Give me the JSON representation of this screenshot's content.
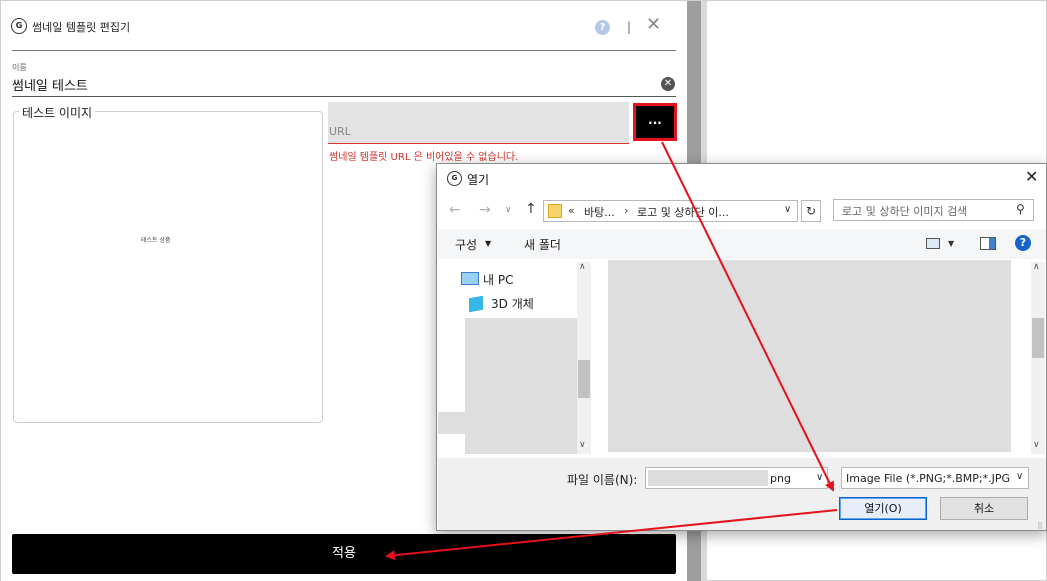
{
  "editor": {
    "icon_glyph": "G",
    "title": "썸네일 템플릿 편집기",
    "help_glyph": "?",
    "separator": "|",
    "close_glyph": "✕",
    "name_label": "이름",
    "name_value": "썸네일 테스트",
    "clear_glyph": "✕",
    "test_image_legend": "테스트 이미지",
    "product_caption": "테스트 상품",
    "url_placeholder": "URL",
    "url_error": "썸네일 템플릿 URL 은 비어있을 수 없습니다.",
    "browse_label": "...",
    "apply_label": "적용"
  },
  "dialog": {
    "icon_glyph": "G",
    "title": "열기",
    "close_glyph": "✕",
    "nav": {
      "back": "←",
      "forward": "→",
      "dropdown": "∨",
      "up": "↑",
      "refresh": "↻"
    },
    "address": {
      "chevron_start": "«",
      "segment1": "바탕...",
      "chevron": "›",
      "segment2": "로고 및 상하단 이...",
      "dropdown": "∨"
    },
    "search_placeholder": "로고 및 상하단 이미지 검색",
    "search_glyph": "⚲",
    "organize_label": "구성",
    "organize_dd": "▼",
    "new_folder_label": "새 폴더",
    "view_dd": "▼",
    "help_glyph": "?",
    "nav_items": [
      {
        "label": "내 PC",
        "icon": "computer-icon"
      },
      {
        "label": "3D 개체",
        "icon": "cube-icon"
      }
    ],
    "scroll_up": "∧",
    "scroll_down": "∨",
    "filename_label": "파일 이름(N):",
    "filename_ext": "png",
    "filename_dd": "∨",
    "filetype_value": "Image File  (*.PNG;*.BMP;*.JPG",
    "filetype_dd": "∨",
    "open_label": "열기(O)",
    "cancel_label": "취소",
    "grip_glyph": "⠿"
  },
  "colors": {
    "annotation_red": "#e3121b",
    "error_red": "#d0312d",
    "button_black": "#000000",
    "help_blue": "#1764c9"
  }
}
